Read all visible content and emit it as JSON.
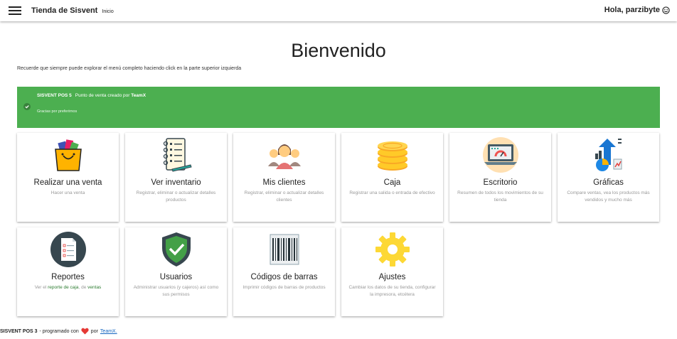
{
  "header": {
    "app_name": "Tienda de Sisvent",
    "section": "Inicio",
    "greeting": "Hola, parzibyte"
  },
  "welcome": {
    "title": "Bienvenido",
    "hint": "Recuerde que siempre puede explorar el menú completo haciendo click en la parte superior izquierda"
  },
  "banner": {
    "app": "SISVENT POS 5",
    "text_prefix": "Punto de venta creado por ",
    "author": "TeamX",
    "subtext": "Gracias por preferirnos"
  },
  "cards": [
    {
      "title": "Realizar una venta",
      "desc": "Hacer una venta",
      "icon": "shopping-bag-icon"
    },
    {
      "title": "Ver inventario",
      "desc": "Registrar, eliminar o actualizar detalles productos",
      "icon": "notebook-icon"
    },
    {
      "title": "Mis clientes",
      "desc": "Registrar, eliminar o actualizar detalles clientes",
      "icon": "customers-icon"
    },
    {
      "title": "Caja",
      "desc": "Registrar una salida o entrada de efectivo",
      "icon": "coins-icon"
    },
    {
      "title": "Escritorio",
      "desc": "Resumen de todos los movimientos de su tienda",
      "icon": "laptop-dashboard-icon"
    },
    {
      "title": "Gráficas",
      "desc": "Compare ventas, vea los productos más vendidos y mucho más",
      "icon": "charts-icon"
    },
    {
      "title": "Reportes",
      "desc_prefix": "Ver el ",
      "desc_link1": "reporte de caja",
      "desc_mid": ", de ",
      "desc_link2": "ventas",
      "icon": "report-icon"
    },
    {
      "title": "Usuarios",
      "desc": "Administrar usuarios (y cajeros) así como sus permisos",
      "icon": "shield-check-icon"
    },
    {
      "title": "Códigos de barras",
      "desc": "Imprimir códigos de barras de productos",
      "icon": "barcode-icon"
    },
    {
      "title": "Ajustes",
      "desc": "Cambiar los datos de su tienda, configurar la impresora, etcétera",
      "icon": "gear-icon"
    }
  ],
  "footer": {
    "app": "SISVENT POS 3",
    "text": "- programado con",
    "by": "por",
    "author": "TeamX."
  },
  "colors": {
    "banner": "#4caf50",
    "link": "#2e7d32",
    "heart": "#e53935"
  }
}
